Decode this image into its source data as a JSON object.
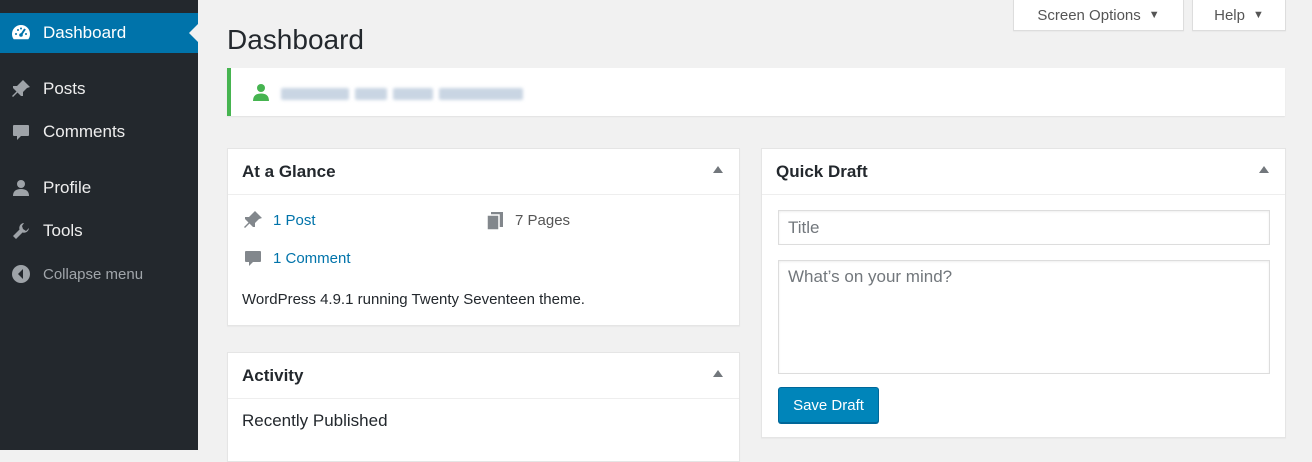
{
  "sidebar": {
    "items": [
      {
        "label": "Dashboard",
        "icon": "dashboard-icon"
      },
      {
        "label": "Posts",
        "icon": "pin-icon"
      },
      {
        "label": "Comments",
        "icon": "comment-icon"
      },
      {
        "label": "Profile",
        "icon": "user-icon"
      },
      {
        "label": "Tools",
        "icon": "wrench-icon"
      },
      {
        "label": "Collapse menu",
        "icon": "collapse-arrow-icon"
      }
    ]
  },
  "header": {
    "screen_options_label": "Screen Options",
    "help_label": "Help",
    "page_title": "Dashboard"
  },
  "at_a_glance": {
    "title": "At a Glance",
    "posts_link": "1 Post",
    "pages_text": "7 Pages",
    "comments_link": "1 Comment",
    "version_text": "WordPress 4.9.1 running Twenty Seventeen theme."
  },
  "activity": {
    "title": "Activity",
    "recently_published": "Recently Published"
  },
  "quick_draft": {
    "title": "Quick Draft",
    "title_placeholder": "Title",
    "content_placeholder": "What’s on your mind?",
    "save_label": "Save Draft"
  },
  "colors": {
    "sidebar_bg": "#23282d",
    "accent": "#0073aa",
    "notice_border": "#46b450",
    "button_primary": "#0085ba"
  }
}
